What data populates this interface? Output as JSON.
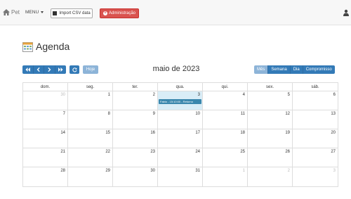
{
  "navbar": {
    "brand": "Pet",
    "menu_label": "MENU",
    "import_label": "Import CSV data",
    "admin_label": "Administração"
  },
  "page": {
    "title": "Agenda"
  },
  "toolbar": {
    "today_label": "Hoje",
    "month_title": "maio de 2023",
    "views": [
      "Mês",
      "Semana",
      "Dia",
      "Compromisso"
    ]
  },
  "calendar": {
    "dow": [
      "dom.",
      "seg.",
      "ter.",
      "qua.",
      "qui.",
      "sex.",
      "sáb."
    ],
    "weeks": [
      [
        "30",
        "1",
        "2",
        "3",
        "4",
        "5",
        "6"
      ],
      [
        "7",
        "8",
        "9",
        "10",
        "11",
        "12",
        "13"
      ],
      [
        "14",
        "15",
        "16",
        "17",
        "18",
        "19",
        "20"
      ],
      [
        "21",
        "22",
        "23",
        "24",
        "25",
        "26",
        "27"
      ],
      [
        "28",
        "29",
        "30",
        "31",
        "1",
        "2",
        "3"
      ]
    ],
    "event": "Fabio - 15:10:00 - Retorno"
  },
  "colors": {
    "primary": "#337ab7",
    "danger": "#d9534f",
    "today": "#d9edf7",
    "event": "#3a87ad"
  }
}
